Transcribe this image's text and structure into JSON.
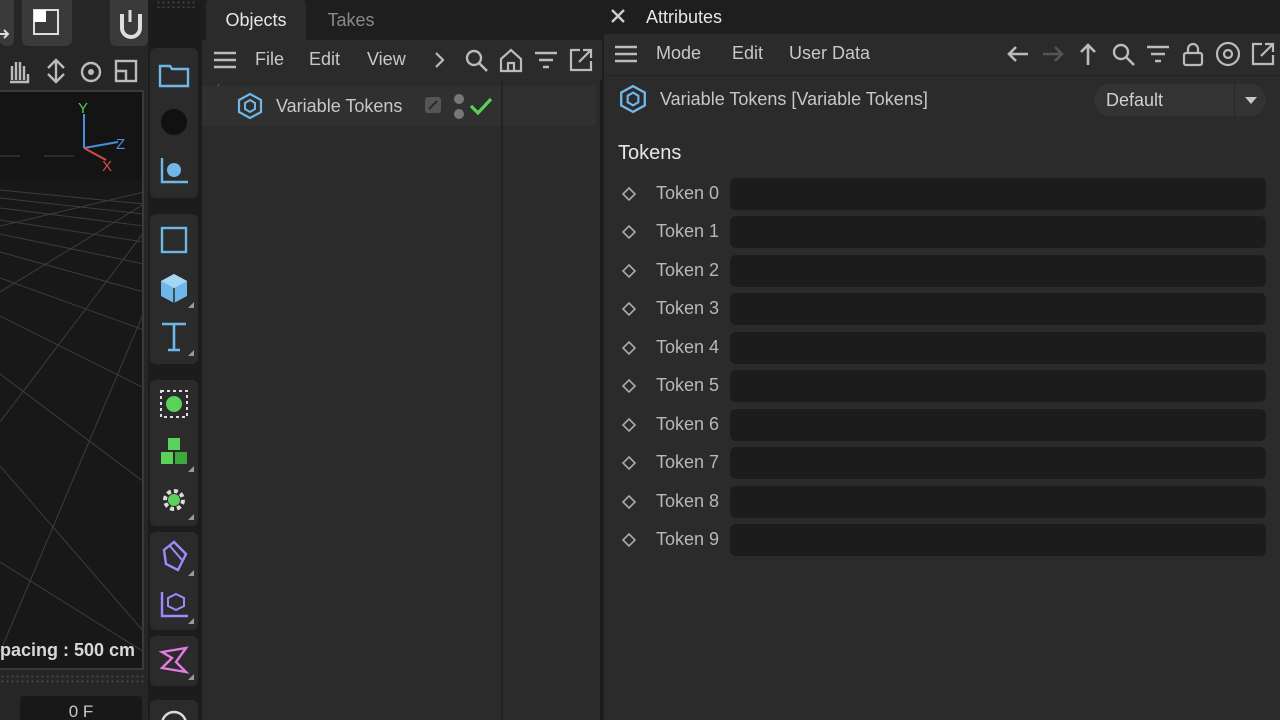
{
  "viewport": {
    "axis_y": "Y",
    "axis_z": "Z",
    "axis_x": "X",
    "grid_spacing": "pacing : 500 cm",
    "frame": "0 F"
  },
  "objects_panel": {
    "tabs": [
      {
        "label": "Objects"
      },
      {
        "label": "Takes"
      }
    ],
    "menu": [
      "File",
      "Edit",
      "View"
    ],
    "object_name": "Variable Tokens"
  },
  "attributes_panel": {
    "title": "Attributes",
    "menu": [
      "Mode",
      "Edit",
      "User Data"
    ],
    "object_label": "Variable Tokens [Variable Tokens]",
    "mode_value": "Default",
    "section_title": "Tokens",
    "tokens": [
      {
        "label": "Token 0",
        "value": ""
      },
      {
        "label": "Token 1",
        "value": ""
      },
      {
        "label": "Token 2",
        "value": ""
      },
      {
        "label": "Token 3",
        "value": ""
      },
      {
        "label": "Token 4",
        "value": ""
      },
      {
        "label": "Token 5",
        "value": ""
      },
      {
        "label": "Token 6",
        "value": ""
      },
      {
        "label": "Token 7",
        "value": ""
      },
      {
        "label": "Token 8",
        "value": ""
      },
      {
        "label": "Token 9",
        "value": ""
      }
    ]
  },
  "colors": {
    "accent_blue": "#6fb7e6",
    "accent_green": "#5ad25a",
    "accent_purple": "#9a8cff",
    "accent_pink": "#e37be0"
  }
}
